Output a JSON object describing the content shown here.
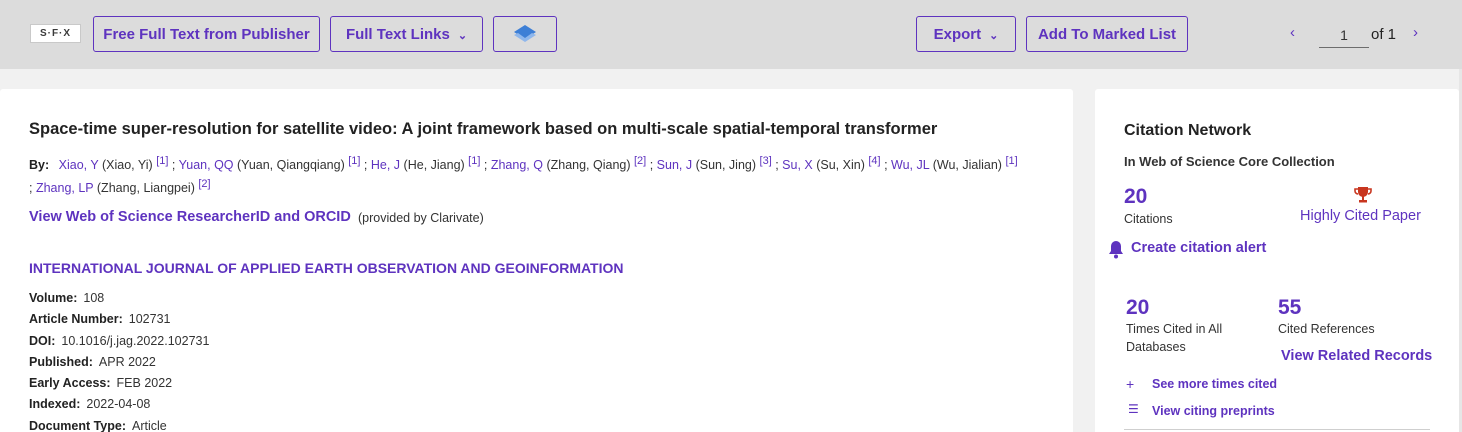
{
  "toolbar": {
    "sfx_logo": "S·F·X",
    "free_full_text": "Free Full Text from Publisher",
    "full_text_links": "Full Text Links",
    "export": "Export",
    "add_marked_list": "Add To Marked List",
    "page_value": "1",
    "page_of": "of 1"
  },
  "record": {
    "title": "Space-time super-resolution for satellite video: A joint framework based on multi-scale spatial-temporal transformer",
    "by_label": "By:",
    "authors": [
      {
        "short": "Xiao, Y",
        "full": "(Xiao, Yi)",
        "aff": "[1]"
      },
      {
        "short": "Yuan, QQ",
        "full": "(Yuan, Qiangqiang)",
        "aff": "[1]"
      },
      {
        "short": "He, J",
        "full": "(He, Jiang)",
        "aff": "[1]"
      },
      {
        "short": "Zhang, Q",
        "full": "(Zhang, Qiang)",
        "aff": "[2]"
      },
      {
        "short": "Sun, J",
        "full": "(Sun, Jing)",
        "aff": "[3]"
      },
      {
        "short": "Su, X",
        "full": "(Su, Xin)",
        "aff": "[4]"
      },
      {
        "short": "Wu, JL",
        "full": "(Wu, Jialian)",
        "aff": "[1]"
      },
      {
        "short": "Zhang, LP",
        "full": "(Zhang, Liangpei)",
        "aff": "[2]"
      }
    ],
    "researcher_link": "View Web of Science ResearcherID and ORCID",
    "researcher_note": "(provided by Clarivate)",
    "journal": "INTERNATIONAL JOURNAL OF APPLIED EARTH OBSERVATION AND GEOINFORMATION",
    "fields": [
      {
        "label": "Volume:",
        "value": "108"
      },
      {
        "label": "Article Number:",
        "value": "102731"
      },
      {
        "label": "DOI:",
        "value": "10.1016/j.jag.2022.102731"
      },
      {
        "label": "Published:",
        "value": "APR 2022"
      },
      {
        "label": "Early Access:",
        "value": "FEB 2022"
      },
      {
        "label": "Indexed:",
        "value": "2022-04-08"
      },
      {
        "label": "Document Type:",
        "value": "Article"
      }
    ]
  },
  "citation": {
    "title": "Citation Network",
    "subtitle": "In Web of Science Core Collection",
    "citations_count": "20",
    "citations_label": "Citations",
    "highly_cited": "Highly Cited Paper",
    "create_alert": "Create citation alert",
    "times_cited_count": "20",
    "times_cited_label": "Times Cited in All Databases",
    "cited_refs_count": "55",
    "cited_refs_label": "Cited References",
    "view_related": "View Related Records",
    "see_more": "See more times cited",
    "view_preprints": "View citing preprints"
  },
  "colors": {
    "accent": "#5e33bf",
    "toolbar_bg": "#dcdcdc",
    "page_bg": "#f1f1f1",
    "trophy": "#c8361f"
  },
  "icons": [
    "chevron-down-icon",
    "layers-icon",
    "chevron-left-icon",
    "chevron-right-icon",
    "trophy-icon",
    "bell-icon",
    "plus-icon",
    "list-icon"
  ]
}
